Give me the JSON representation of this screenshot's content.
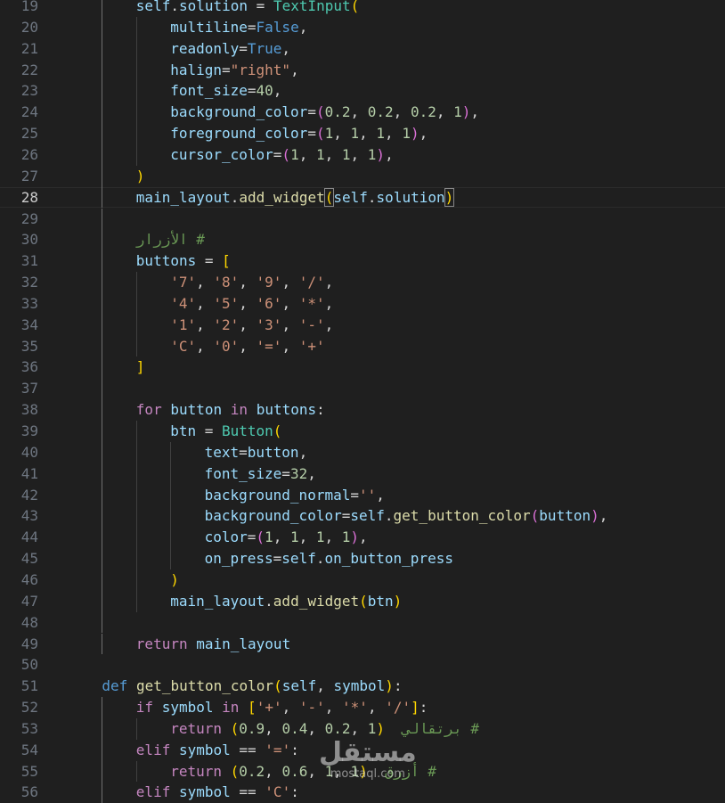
{
  "editor": {
    "current_line": 28,
    "colors": {
      "background": "#1f1f1f",
      "line_number": "#6e7681",
      "variable": "#9cdcfe",
      "class": "#4ec9b0",
      "function": "#dcdcaa",
      "string": "#ce9178",
      "number": "#b5cea8",
      "keyword": "#569cd6",
      "control": "#c586c0",
      "comment": "#6a9955",
      "bracket_1": "#ffd700",
      "bracket_2": "#da70d6",
      "bracket_3": "#179fff"
    },
    "lines": [
      {
        "num": "19",
        "indent": 2,
        "tokens": [
          [
            "var",
            "self"
          ],
          [
            "op",
            "."
          ],
          [
            "var",
            "solution"
          ],
          [
            "op",
            " = "
          ],
          [
            "cls",
            "TextInput"
          ],
          [
            "p1",
            "("
          ]
        ]
      },
      {
        "num": "20",
        "indent": 3,
        "tokens": [
          [
            "var",
            "multiline"
          ],
          [
            "op",
            "="
          ],
          [
            "kw",
            "False"
          ],
          [
            "op",
            ","
          ]
        ]
      },
      {
        "num": "21",
        "indent": 3,
        "tokens": [
          [
            "var",
            "readonly"
          ],
          [
            "op",
            "="
          ],
          [
            "kw",
            "True"
          ],
          [
            "op",
            ","
          ]
        ]
      },
      {
        "num": "22",
        "indent": 3,
        "tokens": [
          [
            "var",
            "halign"
          ],
          [
            "op",
            "="
          ],
          [
            "str",
            "\"right\""
          ],
          [
            "op",
            ","
          ]
        ]
      },
      {
        "num": "23",
        "indent": 3,
        "tokens": [
          [
            "var",
            "font_size"
          ],
          [
            "op",
            "="
          ],
          [
            "num",
            "40"
          ],
          [
            "op",
            ","
          ]
        ]
      },
      {
        "num": "24",
        "indent": 3,
        "tokens": [
          [
            "var",
            "background_color"
          ],
          [
            "op",
            "="
          ],
          [
            "p2",
            "("
          ],
          [
            "num",
            "0.2"
          ],
          [
            "op",
            ", "
          ],
          [
            "num",
            "0.2"
          ],
          [
            "op",
            ", "
          ],
          [
            "num",
            "0.2"
          ],
          [
            "op",
            ", "
          ],
          [
            "num",
            "1"
          ],
          [
            "p2",
            ")"
          ],
          [
            "op",
            ","
          ]
        ]
      },
      {
        "num": "25",
        "indent": 3,
        "tokens": [
          [
            "var",
            "foreground_color"
          ],
          [
            "op",
            "="
          ],
          [
            "p2",
            "("
          ],
          [
            "num",
            "1"
          ],
          [
            "op",
            ", "
          ],
          [
            "num",
            "1"
          ],
          [
            "op",
            ", "
          ],
          [
            "num",
            "1"
          ],
          [
            "op",
            ", "
          ],
          [
            "num",
            "1"
          ],
          [
            "p2",
            ")"
          ],
          [
            "op",
            ","
          ]
        ]
      },
      {
        "num": "26",
        "indent": 3,
        "tokens": [
          [
            "var",
            "cursor_color"
          ],
          [
            "op",
            "="
          ],
          [
            "p2",
            "("
          ],
          [
            "num",
            "1"
          ],
          [
            "op",
            ", "
          ],
          [
            "num",
            "1"
          ],
          [
            "op",
            ", "
          ],
          [
            "num",
            "1"
          ],
          [
            "op",
            ", "
          ],
          [
            "num",
            "1"
          ],
          [
            "p2",
            ")"
          ],
          [
            "op",
            ","
          ]
        ]
      },
      {
        "num": "27",
        "indent": 2,
        "tokens": [
          [
            "p1",
            ")"
          ]
        ]
      },
      {
        "num": "28",
        "indent": 2,
        "tokens": [
          [
            "var",
            "main_layout"
          ],
          [
            "op",
            "."
          ],
          [
            "fn",
            "add_widget"
          ],
          [
            "p1m",
            "("
          ],
          [
            "var",
            "self"
          ],
          [
            "op",
            "."
          ],
          [
            "var",
            "solution"
          ],
          [
            "p1m",
            ")"
          ]
        ]
      },
      {
        "num": "29",
        "indent": 0,
        "tokens": []
      },
      {
        "num": "30",
        "indent": 2,
        "tokens": [
          [
            "cmt",
            "# الأزرار"
          ]
        ]
      },
      {
        "num": "31",
        "indent": 2,
        "tokens": [
          [
            "var",
            "buttons"
          ],
          [
            "op",
            " = "
          ],
          [
            "p1",
            "["
          ]
        ]
      },
      {
        "num": "32",
        "indent": 3,
        "tokens": [
          [
            "str",
            "'7'"
          ],
          [
            "op",
            ", "
          ],
          [
            "str",
            "'8'"
          ],
          [
            "op",
            ", "
          ],
          [
            "str",
            "'9'"
          ],
          [
            "op",
            ", "
          ],
          [
            "str",
            "'/'"
          ],
          [
            "op",
            ","
          ]
        ]
      },
      {
        "num": "33",
        "indent": 3,
        "tokens": [
          [
            "str",
            "'4'"
          ],
          [
            "op",
            ", "
          ],
          [
            "str",
            "'5'"
          ],
          [
            "op",
            ", "
          ],
          [
            "str",
            "'6'"
          ],
          [
            "op",
            ", "
          ],
          [
            "str",
            "'*'"
          ],
          [
            "op",
            ","
          ]
        ]
      },
      {
        "num": "34",
        "indent": 3,
        "tokens": [
          [
            "str",
            "'1'"
          ],
          [
            "op",
            ", "
          ],
          [
            "str",
            "'2'"
          ],
          [
            "op",
            ", "
          ],
          [
            "str",
            "'3'"
          ],
          [
            "op",
            ", "
          ],
          [
            "str",
            "'-'"
          ],
          [
            "op",
            ","
          ]
        ]
      },
      {
        "num": "35",
        "indent": 3,
        "tokens": [
          [
            "str",
            "'C'"
          ],
          [
            "op",
            ", "
          ],
          [
            "str",
            "'0'"
          ],
          [
            "op",
            ", "
          ],
          [
            "str",
            "'='"
          ],
          [
            "op",
            ", "
          ],
          [
            "str",
            "'+'"
          ]
        ]
      },
      {
        "num": "36",
        "indent": 2,
        "tokens": [
          [
            "p1",
            "]"
          ]
        ]
      },
      {
        "num": "37",
        "indent": 0,
        "tokens": []
      },
      {
        "num": "38",
        "indent": 2,
        "tokens": [
          [
            "ctl",
            "for"
          ],
          [
            "op",
            " "
          ],
          [
            "var",
            "button"
          ],
          [
            "op",
            " "
          ],
          [
            "ctl",
            "in"
          ],
          [
            "op",
            " "
          ],
          [
            "var",
            "buttons"
          ],
          [
            "op",
            ":"
          ]
        ]
      },
      {
        "num": "39",
        "indent": 3,
        "tokens": [
          [
            "var",
            "btn"
          ],
          [
            "op",
            " = "
          ],
          [
            "cls",
            "Button"
          ],
          [
            "p1",
            "("
          ]
        ]
      },
      {
        "num": "40",
        "indent": 4,
        "tokens": [
          [
            "var",
            "text"
          ],
          [
            "op",
            "="
          ],
          [
            "var",
            "button"
          ],
          [
            "op",
            ","
          ]
        ]
      },
      {
        "num": "41",
        "indent": 4,
        "tokens": [
          [
            "var",
            "font_size"
          ],
          [
            "op",
            "="
          ],
          [
            "num",
            "32"
          ],
          [
            "op",
            ","
          ]
        ]
      },
      {
        "num": "42",
        "indent": 4,
        "tokens": [
          [
            "var",
            "background_normal"
          ],
          [
            "op",
            "="
          ],
          [
            "str",
            "''"
          ],
          [
            "op",
            ","
          ]
        ]
      },
      {
        "num": "43",
        "indent": 4,
        "tokens": [
          [
            "var",
            "background_color"
          ],
          [
            "op",
            "="
          ],
          [
            "var",
            "self"
          ],
          [
            "op",
            "."
          ],
          [
            "fn",
            "get_button_color"
          ],
          [
            "p2",
            "("
          ],
          [
            "var",
            "button"
          ],
          [
            "p2",
            ")"
          ],
          [
            "op",
            ","
          ]
        ]
      },
      {
        "num": "44",
        "indent": 4,
        "tokens": [
          [
            "var",
            "color"
          ],
          [
            "op",
            "="
          ],
          [
            "p2",
            "("
          ],
          [
            "num",
            "1"
          ],
          [
            "op",
            ", "
          ],
          [
            "num",
            "1"
          ],
          [
            "op",
            ", "
          ],
          [
            "num",
            "1"
          ],
          [
            "op",
            ", "
          ],
          [
            "num",
            "1"
          ],
          [
            "p2",
            ")"
          ],
          [
            "op",
            ","
          ]
        ]
      },
      {
        "num": "45",
        "indent": 4,
        "tokens": [
          [
            "var",
            "on_press"
          ],
          [
            "op",
            "="
          ],
          [
            "var",
            "self"
          ],
          [
            "op",
            "."
          ],
          [
            "var",
            "on_button_press"
          ]
        ]
      },
      {
        "num": "46",
        "indent": 3,
        "tokens": [
          [
            "p1",
            ")"
          ]
        ]
      },
      {
        "num": "47",
        "indent": 3,
        "tokens": [
          [
            "var",
            "main_layout"
          ],
          [
            "op",
            "."
          ],
          [
            "fn",
            "add_widget"
          ],
          [
            "p1",
            "("
          ],
          [
            "var",
            "btn"
          ],
          [
            "p1",
            ")"
          ]
        ]
      },
      {
        "num": "48",
        "indent": 0,
        "tokens": []
      },
      {
        "num": "49",
        "indent": 2,
        "tokens": [
          [
            "ctl",
            "return"
          ],
          [
            "op",
            " "
          ],
          [
            "var",
            "main_layout"
          ]
        ]
      },
      {
        "num": "50",
        "indent": 0,
        "tokens": []
      },
      {
        "num": "51",
        "indent": 1,
        "tokens": [
          [
            "kw",
            "def"
          ],
          [
            "op",
            " "
          ],
          [
            "fn",
            "get_button_color"
          ],
          [
            "p1",
            "("
          ],
          [
            "var",
            "self"
          ],
          [
            "op",
            ", "
          ],
          [
            "var",
            "symbol"
          ],
          [
            "p1",
            ")"
          ],
          [
            "op",
            ":"
          ]
        ]
      },
      {
        "num": "52",
        "indent": 2,
        "tokens": [
          [
            "ctl",
            "if"
          ],
          [
            "op",
            " "
          ],
          [
            "var",
            "symbol"
          ],
          [
            "op",
            " "
          ],
          [
            "ctl",
            "in"
          ],
          [
            "op",
            " "
          ],
          [
            "p1",
            "["
          ],
          [
            "str",
            "'+'"
          ],
          [
            "op",
            ", "
          ],
          [
            "str",
            "'-'"
          ],
          [
            "op",
            ", "
          ],
          [
            "str",
            "'*'"
          ],
          [
            "op",
            ", "
          ],
          [
            "str",
            "'/'"
          ],
          [
            "p1",
            "]"
          ],
          [
            "op",
            ":"
          ]
        ]
      },
      {
        "num": "53",
        "indent": 3,
        "tokens": [
          [
            "ctl",
            "return"
          ],
          [
            "op",
            " "
          ],
          [
            "p1",
            "("
          ],
          [
            "num",
            "0.9"
          ],
          [
            "op",
            ", "
          ],
          [
            "num",
            "0.4"
          ],
          [
            "op",
            ", "
          ],
          [
            "num",
            "0.2"
          ],
          [
            "op",
            ", "
          ],
          [
            "num",
            "1"
          ],
          [
            "p1",
            ")"
          ],
          [
            "op",
            "  "
          ],
          [
            "cmt",
            "# برتقالي"
          ]
        ]
      },
      {
        "num": "54",
        "indent": 2,
        "tokens": [
          [
            "ctl",
            "elif"
          ],
          [
            "op",
            " "
          ],
          [
            "var",
            "symbol"
          ],
          [
            "op",
            " == "
          ],
          [
            "str",
            "'='"
          ],
          [
            "op",
            ":"
          ]
        ]
      },
      {
        "num": "55",
        "indent": 3,
        "tokens": [
          [
            "ctl",
            "return"
          ],
          [
            "op",
            " "
          ],
          [
            "p1",
            "("
          ],
          [
            "num",
            "0.2"
          ],
          [
            "op",
            ", "
          ],
          [
            "num",
            "0.6"
          ],
          [
            "op",
            ", "
          ],
          [
            "num",
            "1"
          ],
          [
            "op",
            ", "
          ],
          [
            "num",
            "1"
          ],
          [
            "p1",
            ")"
          ],
          [
            "op",
            "  "
          ],
          [
            "cmt",
            "# أزرق"
          ]
        ]
      },
      {
        "num": "56",
        "indent": 2,
        "tokens": [
          [
            "ctl",
            "elif"
          ],
          [
            "op",
            " "
          ],
          [
            "var",
            "symbol"
          ],
          [
            "op",
            " == "
          ],
          [
            "str",
            "'C'"
          ],
          [
            "op",
            ":"
          ]
        ]
      }
    ]
  },
  "watermark": {
    "main": "مستقل",
    "sub": "mostaql.com"
  }
}
